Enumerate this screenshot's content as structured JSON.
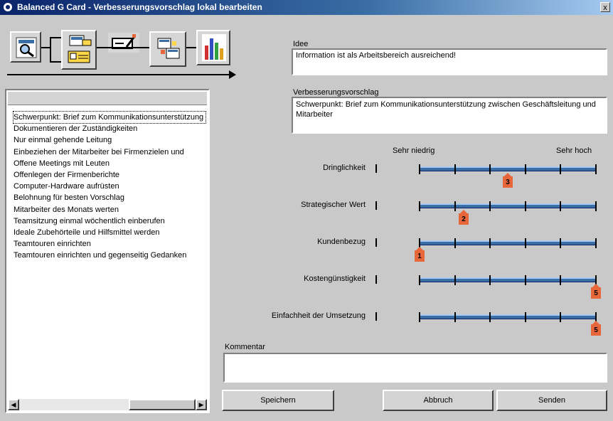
{
  "window": {
    "title": "Balanced G Card - Verbesserungsvorschlag lokal bearbeiten",
    "close_glyph": "x"
  },
  "toolbar": {
    "items": [
      {
        "icon": "magnifier-icon"
      },
      {
        "icon": "workflow-icon"
      },
      {
        "icon": "edit-form-icon"
      },
      {
        "icon": "transfer-icon"
      },
      {
        "icon": "bar-chart-icon"
      }
    ]
  },
  "list": {
    "items": [
      "Schwerpunkt: Brief zum Kommunikationsunterstützung",
      "Dokumentieren der Zuständigkeiten",
      "Nur einmal gehende Leitung",
      "Einbeziehen der Mitarbeiter bei Firmenzielen und",
      "Offene Meetings mit Leuten",
      "Offenlegen der Firmenberichte",
      "Computer-Hardware aufrüsten",
      "Belohnung für besten Vorschlag",
      "Mitarbeiter des Monats werten",
      "Teamsitzung einmal wöchentlich einberufen",
      "Ideale Zubehörteile und Hilfsmittel werden",
      "Teamtouren einrichten",
      "Teamtouren einrichten und gegenseitig Gedanken"
    ],
    "selected_index": 0
  },
  "form": {
    "idea_label": "Idee",
    "idea_value": "Information ist als Arbeitsbereich ausreichend!",
    "proposal_label": "Verbesserungsvorschlag",
    "proposal_value": "Schwerpunkt: Brief zum Kommunikationsunterstützung zwischen Geschäftsleitung und Mitarbeiter",
    "scale_low_label": "Sehr niedrig",
    "scale_high_label": "Sehr hoch",
    "comment_label": "Kommentar",
    "comment_value": ""
  },
  "ratings": [
    {
      "label": "Dringlichkeit",
      "value": 3,
      "max": 5
    },
    {
      "label": "Strategischer Wert",
      "value": 2,
      "max": 5
    },
    {
      "label": "Kundenbezug",
      "value": 1,
      "max": 5
    },
    {
      "label": "Kostengünstigkeit",
      "value": 5,
      "max": 5
    },
    {
      "label": "Einfachheit der Umsetzung",
      "value": 5,
      "max": 5
    }
  ],
  "buttons": {
    "save": "Speichern",
    "cancel": "Abbruch",
    "send": "Senden"
  },
  "colors": {
    "track": "#3a6ea5",
    "marker": "#e8673a",
    "titlebar": "#0a246a"
  }
}
